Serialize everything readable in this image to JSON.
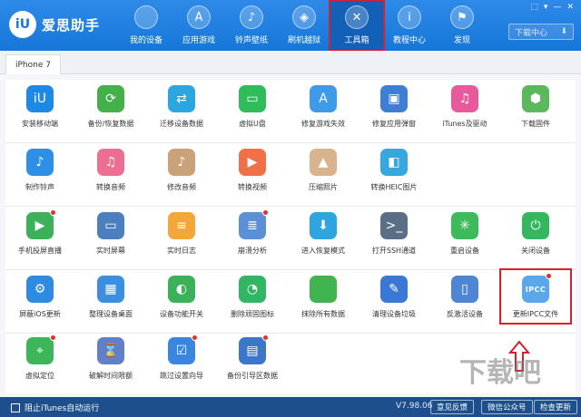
{
  "app": {
    "logo_mark": "iU",
    "name": "爱思助手"
  },
  "nav": [
    {
      "label": "我的设备",
      "icon": "apple-icon",
      "glyph": ""
    },
    {
      "label": "应用游戏",
      "icon": "app-store-icon",
      "glyph": "A"
    },
    {
      "label": "铃声壁纸",
      "icon": "briefcase-icon",
      "glyph": "♪"
    },
    {
      "label": "刷机越狱",
      "icon": "dropbox-icon",
      "glyph": "◈"
    },
    {
      "label": "工具箱",
      "icon": "tools-icon",
      "glyph": "✕",
      "active": true
    },
    {
      "label": "教程中心",
      "icon": "info-icon",
      "glyph": "i"
    },
    {
      "label": "发现",
      "icon": "flag-icon",
      "glyph": "⚑"
    }
  ],
  "window_controls": [
    "⬚",
    "▾",
    "—",
    "✕"
  ],
  "download_center": {
    "label": "下载中心",
    "glyph": "⬇"
  },
  "device_tab": "iPhone 7",
  "rows": [
    [
      {
        "label": "安装移动端",
        "color": "#1e88e5",
        "glyph": "iU",
        "icon": "iu-logo-icon"
      },
      {
        "label": "备份/恢复数据",
        "color": "#43b04a",
        "glyph": "⟳",
        "icon": "backup-icon"
      },
      {
        "label": "迁移设备数据",
        "color": "#2aa6e0",
        "glyph": "⇄",
        "icon": "migrate-icon"
      },
      {
        "label": "虚拟U盘",
        "color": "#2fbd5a",
        "glyph": "▭",
        "icon": "usb-drive-icon"
      },
      {
        "label": "修复游戏失效",
        "color": "#3d9be9",
        "glyph": "A",
        "icon": "app-store-icon"
      },
      {
        "label": "修复应用弹窗",
        "color": "#3c7fd4",
        "glyph": "▣",
        "icon": "apple-id-icon"
      },
      {
        "label": "iTunes及驱动",
        "color": "#e85a9b",
        "glyph": "♫",
        "icon": "itunes-icon"
      },
      {
        "label": "下载固件",
        "color": "#5cb85c",
        "glyph": "⬢",
        "icon": "firmware-icon"
      }
    ],
    [
      {
        "label": "制作铃声",
        "color": "#2e8fe6",
        "glyph": "♪",
        "icon": "bell-icon"
      },
      {
        "label": "转换音频",
        "color": "#ec6f93",
        "glyph": "♫",
        "icon": "music-icon"
      },
      {
        "label": "修改音频",
        "color": "#c9a27a",
        "glyph": "♪",
        "icon": "audio-edit-icon"
      },
      {
        "label": "转换视频",
        "color": "#f07048",
        "glyph": "▶",
        "icon": "video-icon"
      },
      {
        "label": "压缩照片",
        "color": "#d8b38e",
        "glyph": "▲",
        "icon": "photo-icon"
      },
      {
        "label": "转换HEIC图片",
        "color": "#35a8df",
        "glyph": "◧",
        "icon": "heic-image-icon"
      }
    ],
    [
      {
        "label": "手机投屏直播",
        "color": "#3bb25a",
        "glyph": "▶",
        "icon": "screen-mirror-icon",
        "dot": true
      },
      {
        "label": "实时屏幕",
        "color": "#4c7fc0",
        "glyph": "▭",
        "icon": "monitor-icon"
      },
      {
        "label": "实时日志",
        "color": "#f3a73a",
        "glyph": "≡",
        "icon": "log-icon"
      },
      {
        "label": "崩溃分析",
        "color": "#5b8fd6",
        "glyph": "≣",
        "icon": "crash-analysis-icon",
        "dot": true
      },
      {
        "label": "进入恢复模式",
        "color": "#2da6e0",
        "glyph": "⬇",
        "icon": "recovery-mode-icon"
      },
      {
        "label": "打开SSH通道",
        "color": "#5a6e86",
        "glyph": ">_",
        "icon": "ssh-terminal-icon"
      },
      {
        "label": "重启设备",
        "color": "#3dbb5a",
        "glyph": "✳",
        "icon": "restart-icon"
      },
      {
        "label": "关闭设备",
        "color": "#33b860",
        "glyph": "⏻",
        "icon": "power-icon"
      }
    ],
    [
      {
        "label": "屏蔽iOS更新",
        "color": "#2e8be2",
        "glyph": "⚙",
        "icon": "block-update-icon"
      },
      {
        "label": "整理设备桌面",
        "color": "#3a8fe0",
        "glyph": "▦",
        "icon": "desktop-grid-icon"
      },
      {
        "label": "设备功能开关",
        "color": "#3bb25a",
        "glyph": "◐",
        "icon": "toggle-icon"
      },
      {
        "label": "删除顽固图标",
        "color": "#31b763",
        "glyph": "◔",
        "icon": "delete-icon"
      },
      {
        "label": "抹除所有数据",
        "color": "#3fb44f",
        "glyph": "",
        "icon": "erase-apple-icon"
      },
      {
        "label": "清理设备垃圾",
        "color": "#3a78d8",
        "glyph": "✎",
        "icon": "broom-icon"
      },
      {
        "label": "反激活设备",
        "color": "#4e86d4",
        "glyph": "▯",
        "icon": "deactivate-icon"
      },
      {
        "label": "更新IPCC文件",
        "color": "#5ba7ec",
        "glyph": "IPCC",
        "icon": "ipcc-icon",
        "dot": true,
        "highlight": true
      }
    ],
    [
      {
        "label": "虚拟定位",
        "color": "#3db65a",
        "glyph": "⌖",
        "icon": "location-pin-icon",
        "dot": true
      },
      {
        "label": "破解时间限额",
        "color": "#6180c8",
        "glyph": "⌛",
        "icon": "hourglass-icon"
      },
      {
        "label": "跳过设置向导",
        "color": "#3a85dd",
        "glyph": "☑",
        "icon": "skip-setup-icon",
        "dot": true
      },
      {
        "label": "备份引导区数据",
        "color": "#3c76c9",
        "glyph": "▤",
        "icon": "boot-backup-icon",
        "dot": true
      }
    ]
  ],
  "footer": {
    "checkbox_label": "阻止iTunes自动运行",
    "version": "V7.98.06",
    "feedback": "意见反馈",
    "wechat": "微信公众号",
    "check_update": "检查更新"
  },
  "watermark": "下载吧"
}
